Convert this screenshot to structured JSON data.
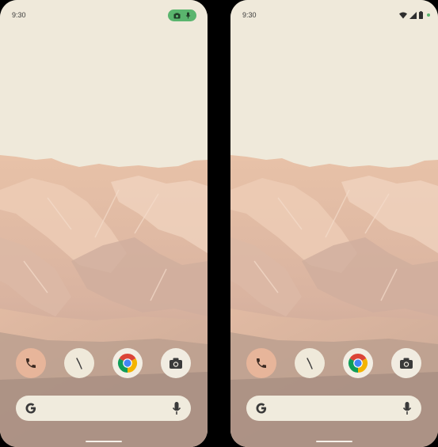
{
  "screens": [
    {
      "status_bar": {
        "time": "9:30",
        "indicator": "privacy-chip",
        "indicator_icons": [
          "camera-icon",
          "microphone-icon"
        ],
        "indicator_color": "#5ab56e"
      },
      "dock": [
        "phone-icon",
        "clock-icon",
        "chrome-icon",
        "camera-icon"
      ],
      "search_bar": {
        "left_icon": "google-g-icon",
        "right_icon": "microphone-icon"
      }
    },
    {
      "status_bar": {
        "time": "9:30",
        "icons": [
          "wifi-icon",
          "cellular-signal-icon",
          "battery-icon",
          "green-dot"
        ],
        "dot_color": "#5ab56e"
      },
      "dock": [
        "phone-icon",
        "clock-icon",
        "chrome-icon",
        "camera-icon"
      ],
      "search_bar": {
        "left_icon": "google-g-icon",
        "right_icon": "microphone-icon"
      }
    }
  ],
  "colors": {
    "sky": "#efe9da",
    "background": "#000000",
    "phone_app": "#e7b59a"
  }
}
